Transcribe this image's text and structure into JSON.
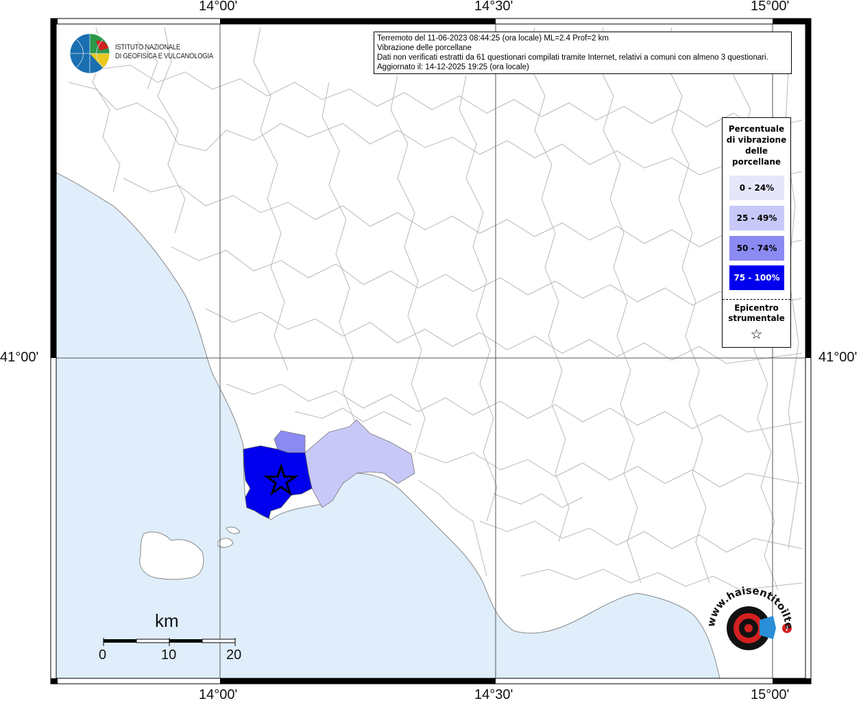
{
  "coordinates": {
    "top": [
      "14°00'",
      "14°30'",
      "15°00'"
    ],
    "bottom": [
      "14°00'",
      "14°30'",
      "15°00'"
    ],
    "left_lat": "41°00'",
    "right_lat": "41°00'"
  },
  "header": {
    "line1": "Terremoto del 11-06-2023 08:44:25 (ora locale) ML=2.4 Prof=2 km",
    "line2": "Vibrazione delle porcellane",
    "line3": "Dati non verificati estratti da 61 questionari compilati tramite Internet, relativi a comuni con almeno 3 questionari.",
    "line4": "Aggiornato il: 14-12-2025 19:25 (ora locale)"
  },
  "logo": {
    "line1": "ISTITUTO NAZIONALE",
    "line2": "DI GEOFISICA E VULCANOLOGIA"
  },
  "legend": {
    "title": [
      "Percentuale",
      "di vibrazione",
      "delle",
      "porcellane"
    ],
    "items": [
      {
        "label": "0 - 24%",
        "color": "#e6e6fb"
      },
      {
        "label": "25 - 49%",
        "color": "#c8c8f8"
      },
      {
        "label": "50 - 74%",
        "color": "#8a8af2"
      },
      {
        "label": "75 - 100%",
        "color": "#0000ee"
      }
    ],
    "epicenter_title": [
      "Epicentro",
      "strumentale"
    ],
    "epicenter_symbol": "☆"
  },
  "scale": {
    "unit": "km",
    "ticks": [
      "0",
      "10",
      "20"
    ]
  },
  "watermark": {
    "text": "www.haisentitoilterremoto.it",
    "colors": {
      "red": "#d42020",
      "blue": "#2a8fd6"
    }
  },
  "colors": {
    "sea": "#dfeefa",
    "land": "#ffffff",
    "boundary": "#b0b0b0",
    "frame": "#000000"
  }
}
